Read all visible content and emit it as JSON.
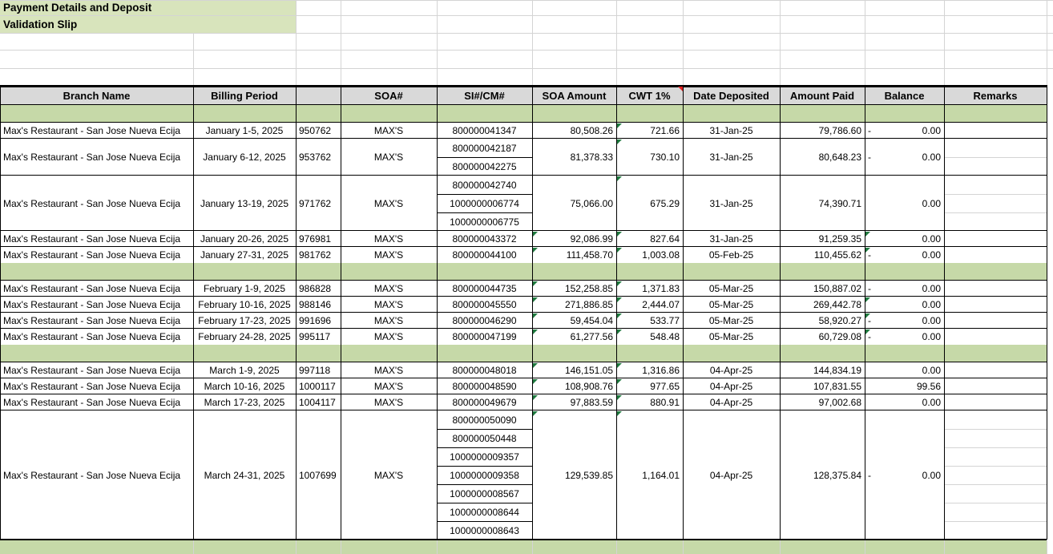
{
  "title_line1": "Payment Details and Deposit",
  "title_line2": "Validation Slip",
  "headers": [
    "Branch Name",
    "Billing Period",
    "",
    "SOA#",
    "SI#/CM#",
    "SOA Amount",
    "CWT 1%",
    "Date Deposited",
    "Amount Paid",
    "Balance",
    "Remarks"
  ],
  "colors": {
    "green": "#c6d9a8",
    "title_green": "#d8e4bc",
    "header_gray": "#d9d9d9"
  },
  "rows": [
    {
      "branch": "Max's Restaurant - San Jose Nueva Ecija",
      "period": "January 1-5, 2025",
      "num": "950762",
      "soa": "MAX'S",
      "si": [
        "800000041347"
      ],
      "soa_amount": "80,508.26",
      "cwt": "721.66",
      "date": "31-Jan-25",
      "paid": "79,786.60",
      "dash": "-",
      "balance": "0.00"
    },
    {
      "branch": "Max's Restaurant - San Jose Nueva Ecija",
      "period": "January 6-12, 2025",
      "num": "953762",
      "soa": "MAX'S",
      "si": [
        "800000042187",
        "800000042275"
      ],
      "soa_amount": "81,378.33",
      "cwt": "730.10",
      "date": "31-Jan-25",
      "paid": "80,648.23",
      "dash": "-",
      "balance": "0.00"
    },
    {
      "branch": "Max's Restaurant - San Jose Nueva Ecija",
      "period": "January 13-19, 2025",
      "num": "971762",
      "soa": "MAX'S",
      "si": [
        "800000042740",
        "1000000006774",
        "1000000006775"
      ],
      "soa_amount": "75,066.00",
      "cwt": "675.29",
      "date": "31-Jan-25",
      "paid": "74,390.71",
      "dash": "",
      "balance": "0.00"
    },
    {
      "branch": "Max's Restaurant - San Jose Nueva Ecija",
      "period": "January 20-26, 2025",
      "num": "976981",
      "soa": "MAX'S",
      "si": [
        "800000043372"
      ],
      "soa_amount": "92,086.99",
      "cwt": "827.64",
      "date": "31-Jan-25",
      "paid": "91,259.35",
      "dash": "",
      "balance": "0.00"
    },
    {
      "branch": "Max's Restaurant - San Jose Nueva Ecija",
      "period": "January 27-31, 2025",
      "num": "981762",
      "soa": "MAX'S",
      "si": [
        "800000044100"
      ],
      "soa_amount": "111,458.70",
      "cwt": "1,003.08",
      "date": "05-Feb-25",
      "paid": "110,455.62",
      "dash": "-",
      "balance": "0.00"
    },
    {
      "branch": "Max's Restaurant - San Jose Nueva Ecija",
      "period": "February 1-9, 2025",
      "num": "986828",
      "soa": "MAX'S",
      "si": [
        "800000044735"
      ],
      "soa_amount": "152,258.85",
      "cwt": "1,371.83",
      "date": "05-Mar-25",
      "paid": "150,887.02",
      "dash": "-",
      "balance": "0.00"
    },
    {
      "branch": "Max's Restaurant - San Jose Nueva Ecija",
      "period": "February 10-16, 2025",
      "num": "988146",
      "soa": "MAX'S",
      "si": [
        "800000045550"
      ],
      "soa_amount": "271,886.85",
      "cwt": "2,444.07",
      "date": "05-Mar-25",
      "paid": "269,442.78",
      "dash": "",
      "balance": "0.00"
    },
    {
      "branch": "Max's Restaurant - San Jose Nueva Ecija",
      "period": "February 17-23, 2025",
      "num": "991696",
      "soa": "MAX'S",
      "si": [
        "800000046290"
      ],
      "soa_amount": "59,454.04",
      "cwt": "533.77",
      "date": "05-Mar-25",
      "paid": "58,920.27",
      "dash": "-",
      "balance": "0.00"
    },
    {
      "branch": "Max's Restaurant - San Jose Nueva Ecija",
      "period": "February 24-28, 2025",
      "num": "995117",
      "soa": "MAX'S",
      "si": [
        "800000047199"
      ],
      "soa_amount": "61,277.56",
      "cwt": "548.48",
      "date": "05-Mar-25",
      "paid": "60,729.08",
      "dash": "-",
      "balance": "0.00"
    },
    {
      "branch": "Max's Restaurant - San Jose Nueva Ecija",
      "period": "March 1-9, 2025",
      "num": "997118",
      "soa": "MAX'S",
      "si": [
        "800000048018"
      ],
      "soa_amount": "146,151.05",
      "cwt": "1,316.86",
      "date": "04-Apr-25",
      "paid": "144,834.19",
      "dash": "",
      "balance": "0.00"
    },
    {
      "branch": "Max's Restaurant - San Jose Nueva Ecija",
      "period": "March 10-16, 2025",
      "num": "1000117",
      "soa": "MAX'S",
      "si": [
        "800000048590"
      ],
      "soa_amount": "108,908.76",
      "cwt": "977.65",
      "date": "04-Apr-25",
      "paid": "107,831.55",
      "dash": "",
      "balance": "99.56"
    },
    {
      "branch": "Max's Restaurant - San Jose Nueva Ecija",
      "period": "March 17-23, 2025",
      "num": "1004117",
      "soa": "MAX'S",
      "si": [
        "800000049679"
      ],
      "soa_amount": "97,883.59",
      "cwt": "880.91",
      "date": "04-Apr-25",
      "paid": "97,002.68",
      "dash": "",
      "balance": "0.00"
    },
    {
      "branch": "Max's Restaurant - San Jose Nueva Ecija",
      "period": "March 24-31, 2025",
      "num": "1007699",
      "soa": "MAX'S",
      "si": [
        "800000050090",
        "800000050448",
        "1000000009357",
        "1000000009358",
        "1000000008567",
        "1000000008644",
        "1000000008643"
      ],
      "soa_amount": "129,539.85",
      "cwt": "1,164.01",
      "date": "04-Apr-25",
      "paid": "128,375.84",
      "dash": "-",
      "balance": "0.00"
    }
  ]
}
